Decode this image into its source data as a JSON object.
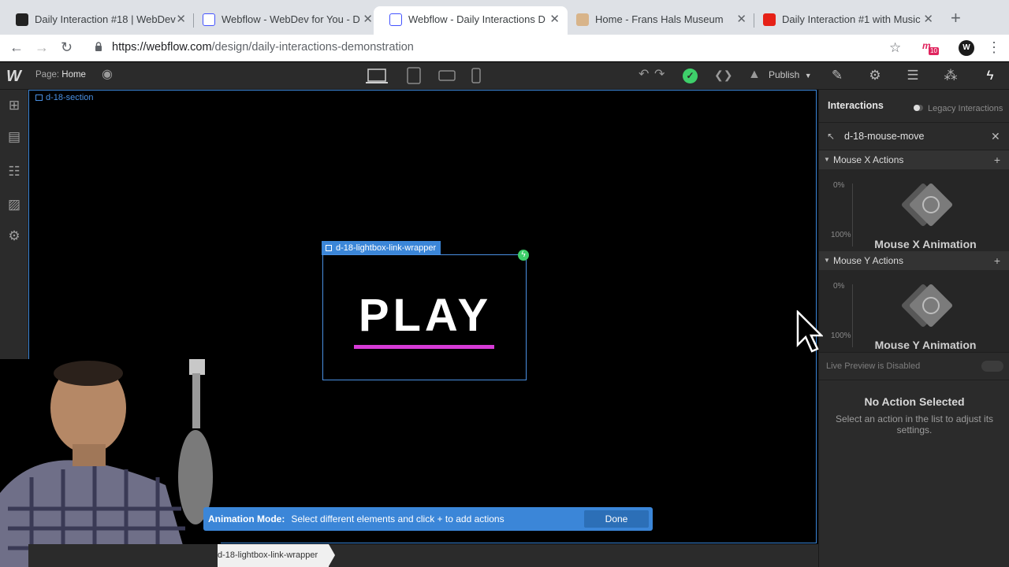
{
  "browser": {
    "tabs": [
      {
        "label": "Daily Interaction #18 | WebDev",
        "favicon": "webflow-dark",
        "active": false
      },
      {
        "label": "Webflow - WebDev for You - D",
        "favicon": "webflow-blue",
        "active": false
      },
      {
        "label": "Webflow - Daily Interactions D",
        "favicon": "webflow-blue",
        "active": true
      },
      {
        "label": "Home - Frans Hals Museum",
        "favicon": "museum",
        "active": false
      },
      {
        "label": "Daily Interaction #1 with Music",
        "favicon": "youtube",
        "active": false
      }
    ],
    "url_host": "https://webflow.com",
    "url_path": "/design/daily-interactions-demonstration",
    "extension_badge": "10"
  },
  "topbar": {
    "page_prefix": "Page:",
    "page_name": "Home",
    "publish_label": "Publish"
  },
  "canvas": {
    "section_label": "d-18-section",
    "wrapper_label": "d-18-lightbox-link-wrapper",
    "play_text": "PLAY"
  },
  "animation_bar": {
    "mode_label": "Animation Mode:",
    "message": "Select different elements and click + to add actions",
    "done_label": "Done"
  },
  "breadcrumb": {
    "item": "d-18-lightbox-link-wrapper"
  },
  "panel": {
    "title": "Interactions",
    "legacy_label": "Legacy Interactions",
    "interaction_name": "d-18-mouse-move",
    "mouse_x": {
      "header": "Mouse X Actions",
      "pct_start": "0%",
      "pct_end": "100%",
      "animation_label": "Mouse X Animation"
    },
    "mouse_y": {
      "header": "Mouse Y Actions",
      "pct_start": "0%",
      "pct_end": "100%",
      "animation_label": "Mouse Y Animation"
    },
    "live_preview": "Live Preview is Disabled",
    "no_action_title": "No Action Selected",
    "no_action_desc": "Select an action in the list to adjust its settings."
  },
  "colors": {
    "accent_blue": "#3b86d8",
    "underline_magenta": "#d63bd6",
    "status_green": "#3ecf6a"
  }
}
